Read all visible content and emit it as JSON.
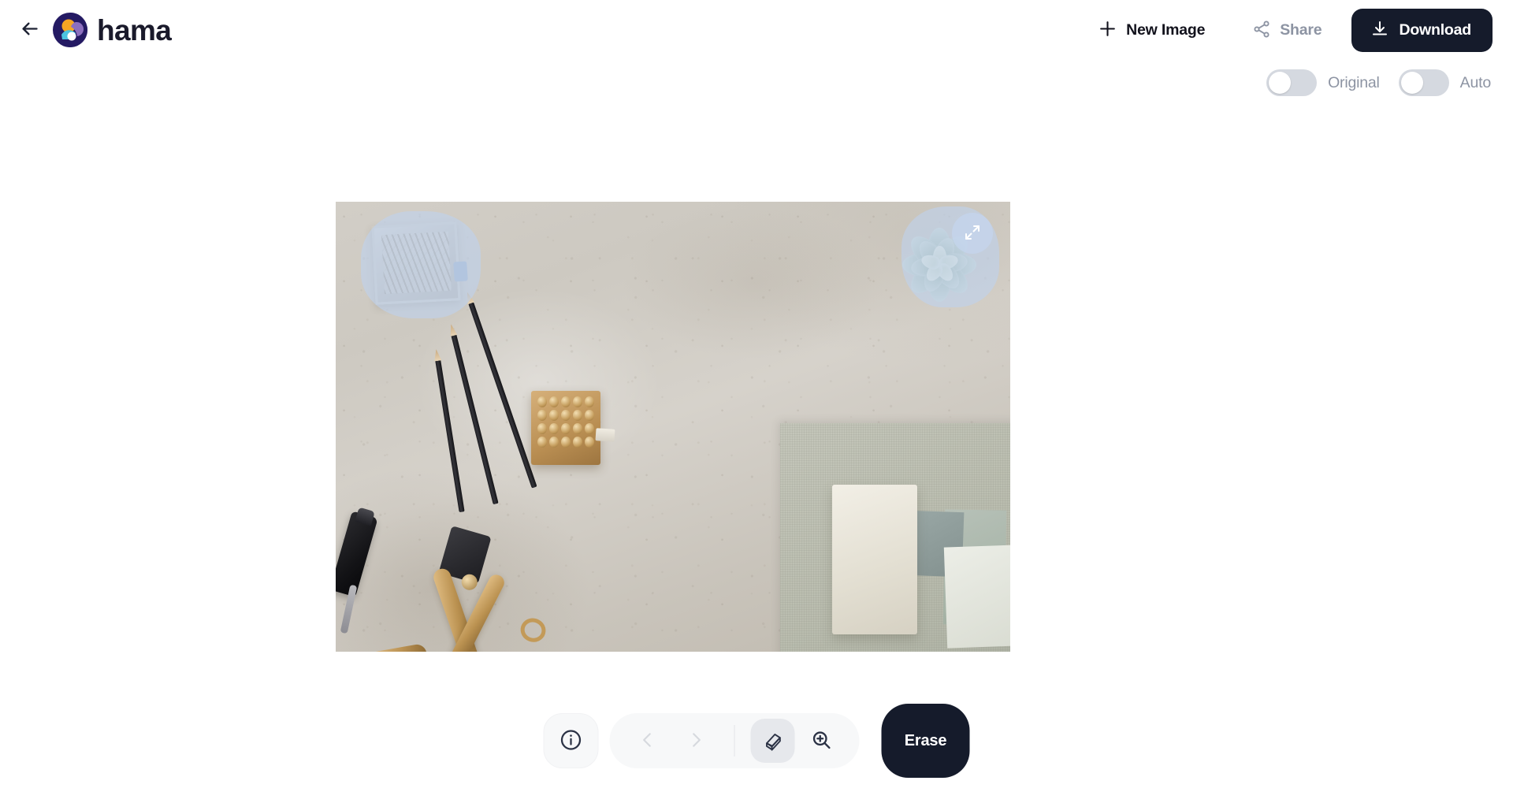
{
  "app": {
    "brand_name": "hama",
    "background_color": "#ffffff",
    "accent_dark": "#151b2b",
    "muted_text": "#8d94a3",
    "mask_color": "#bfd2ee"
  },
  "topbar": {
    "back_icon": "arrow-left-icon",
    "logo_icon": "hama-logo-icon",
    "new_image": {
      "label": "New Image",
      "icon": "plus-icon"
    },
    "share": {
      "label": "Share",
      "icon": "share-nodes-icon"
    },
    "download": {
      "label": "Download",
      "icon": "download-icon"
    }
  },
  "toggles": [
    {
      "label": "Original",
      "state": "off",
      "name": "original-toggle"
    },
    {
      "label": "Auto",
      "state": "off",
      "name": "auto-toggle"
    }
  ],
  "canvas": {
    "image_alt": "Flat-lay photo of a desk with pencils, brass hole punch, binder clip, paperclip box, stamp block, notebook and a succulent",
    "expand_icon": "expand-arrows-icon",
    "mask_count": 2,
    "masks": [
      {
        "name": "mask-paperclip-box",
        "color": "#bfd2ee"
      },
      {
        "name": "mask-succulent",
        "color": "#bfd2ee"
      }
    ]
  },
  "toolbar": {
    "info": {
      "icon": "info-circle-icon",
      "label": ""
    },
    "undo": {
      "icon": "chevron-left-icon",
      "enabled": false
    },
    "redo": {
      "icon": "chevron-right-icon",
      "enabled": false
    },
    "eraser": {
      "icon": "eraser-icon",
      "active": true
    },
    "zoom": {
      "icon": "magnifier-plus-icon",
      "active": false
    },
    "erase_button": {
      "label": "Erase"
    }
  }
}
